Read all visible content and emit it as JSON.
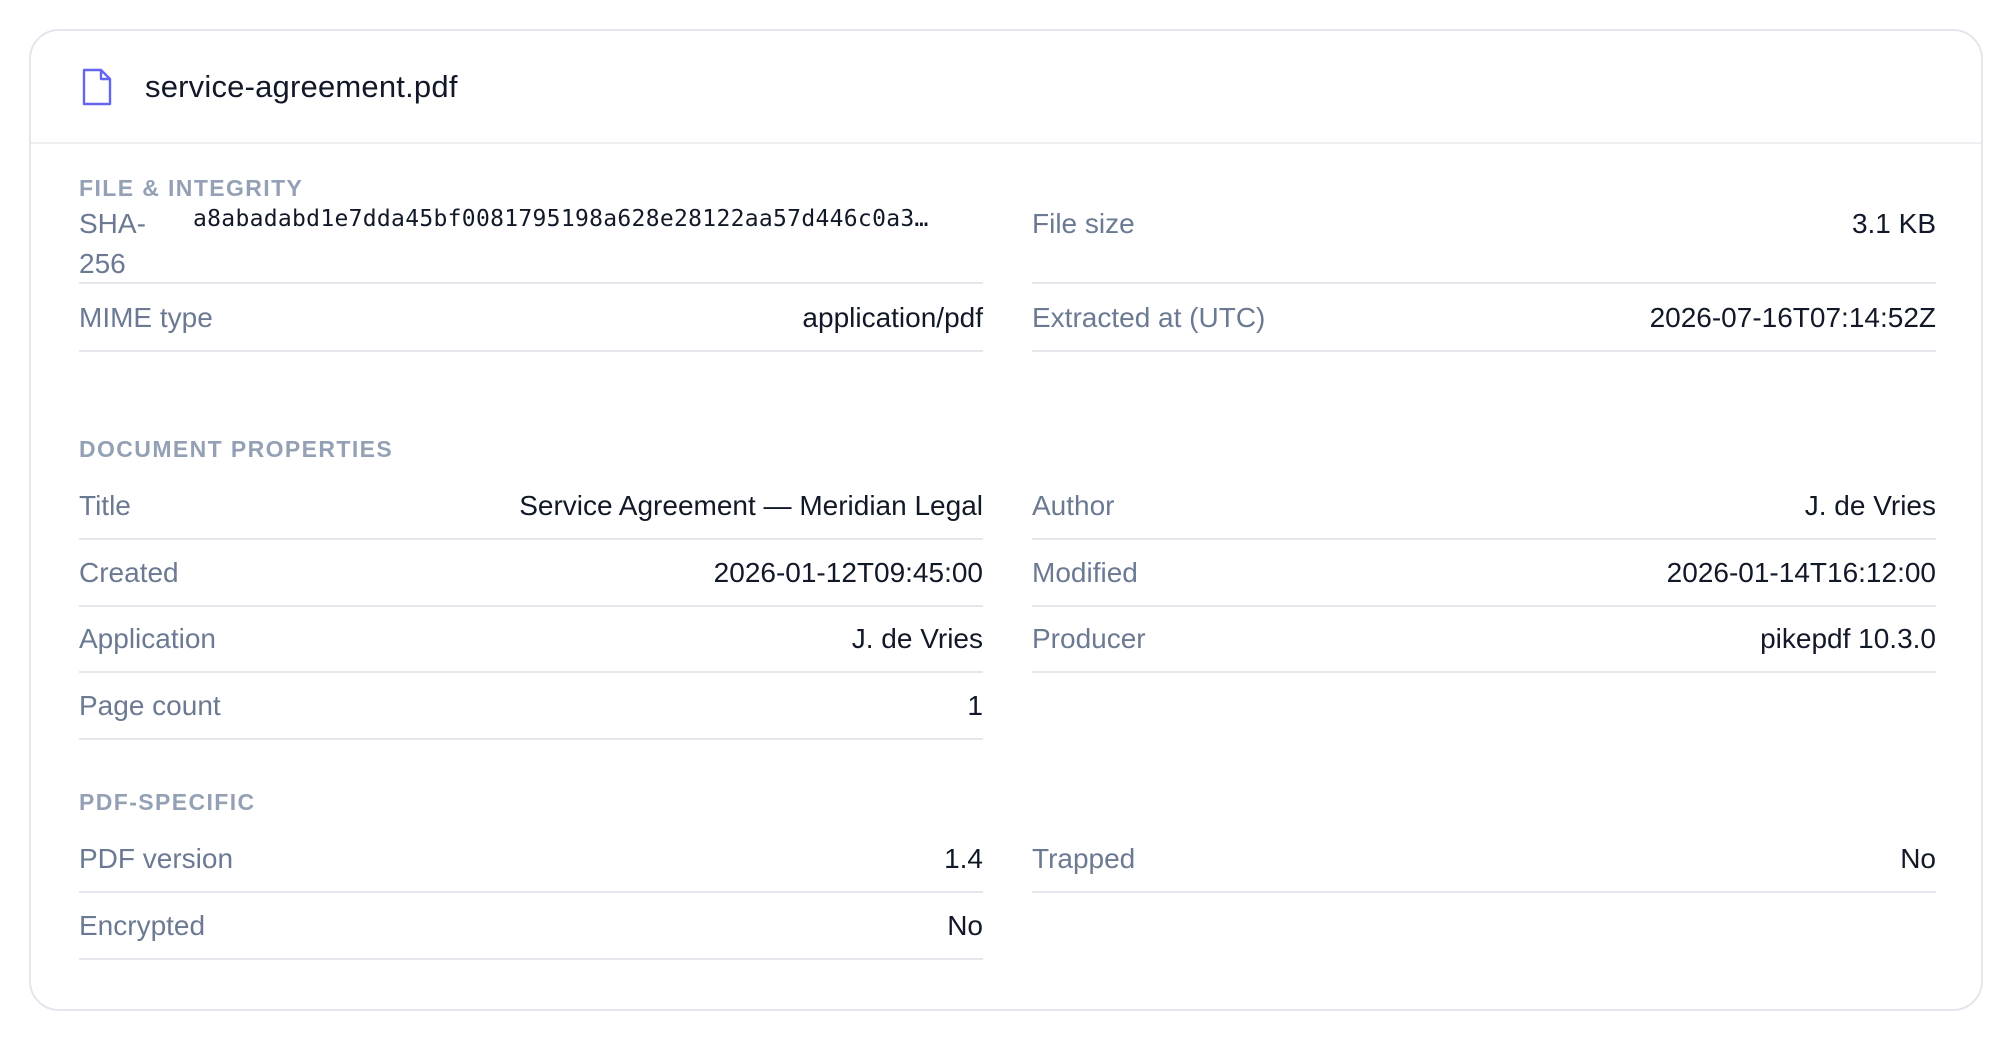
{
  "header": {
    "file_name": "service-agreement.pdf",
    "icon": "file-icon",
    "icon_color": "#6366f1"
  },
  "sections": {
    "file_integrity": {
      "title": "FILE & INTEGRITY",
      "sha256_label": "SHA-256",
      "sha256_value": "a8abadabd1e7dda45bf0081795198a628e28122aa57d446c0a3…",
      "file_size_label": "File size",
      "file_size_value": "3.1 KB",
      "mime_label": "MIME type",
      "mime_value": "application/pdf",
      "extracted_label": "Extracted at (UTC)",
      "extracted_value": "2026-07-16T07:14:52Z"
    },
    "document_properties": {
      "title": "DOCUMENT PROPERTIES",
      "title_label": "Title",
      "title_value": "Service Agreement — Meridian Legal",
      "author_label": "Author",
      "author_value": "J. de Vries",
      "created_label": "Created",
      "created_value": "2026-01-12T09:45:00",
      "modified_label": "Modified",
      "modified_value": "2026-01-14T16:12:00",
      "application_label": "Application",
      "application_value": "J. de Vries",
      "producer_label": "Producer",
      "producer_value": "pikepdf 10.3.0",
      "page_count_label": "Page count",
      "page_count_value": "1"
    },
    "pdf_specific": {
      "title": "PDF-SPECIFIC",
      "pdf_version_label": "PDF version",
      "pdf_version_value": "1.4",
      "trapped_label": "Trapped",
      "trapped_value": "No",
      "encrypted_label": "Encrypted",
      "encrypted_value": "No"
    }
  },
  "colors": {
    "label": "#6b7a92",
    "section_title": "#94a1b5",
    "value": "#111827",
    "divider": "#e4e7ec",
    "border": "#e3e6ec"
  }
}
